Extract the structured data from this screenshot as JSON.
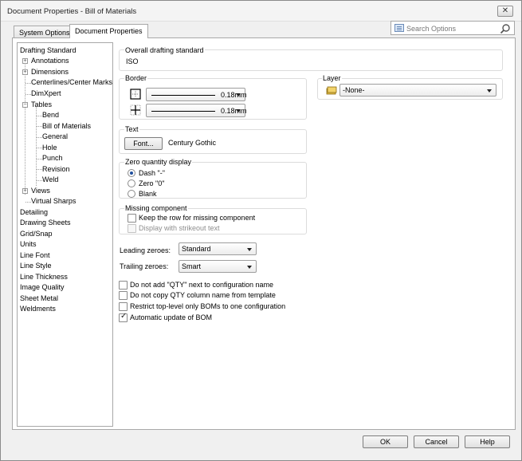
{
  "window": {
    "title": "Document Properties - Bill of Materials",
    "close_glyph": "✕"
  },
  "tabs": {
    "system_options": "System Options",
    "document_properties": "Document Properties"
  },
  "search": {
    "placeholder": "Search Options"
  },
  "tree": {
    "items": [
      "Drafting Standard",
      "Annotations",
      "Dimensions",
      "Centerlines/Center Marks",
      "DimXpert",
      "Tables",
      "Bend",
      "Bill of Materials",
      "General",
      "Hole",
      "Punch",
      "Revision",
      "Weld",
      "Views",
      "Virtual Sharps",
      "Detailing",
      "Drawing Sheets",
      "Grid/Snap",
      "Units",
      "Line Font",
      "Line Style",
      "Line Thickness",
      "Image Quality",
      "Sheet Metal",
      "Weldments"
    ]
  },
  "overall": {
    "label": "Overall drafting standard",
    "value": "ISO"
  },
  "border": {
    "label": "Border",
    "row1_value": "0.18mm",
    "row2_value": "0.18mm"
  },
  "layer": {
    "label": "Layer",
    "value": "-None-"
  },
  "text": {
    "label": "Text",
    "font_button": "Font...",
    "font_name": "Century Gothic"
  },
  "zero_qty": {
    "label": "Zero quantity display",
    "options": [
      "Dash \"-\"",
      "Zero \"0\"",
      "Blank"
    ],
    "selected": "Dash \"-\""
  },
  "missing": {
    "label": "Missing component",
    "keep_row": "Keep the row for missing component",
    "strikeout": "Display with strikeout text"
  },
  "leading": {
    "label": "Leading zeroes:",
    "value": "Standard"
  },
  "trailing": {
    "label": "Trailing zeroes:",
    "value": "Smart"
  },
  "options": {
    "no_qty": "Do not add \"QTY\" next to configuration name",
    "no_copy": "Do not copy QTY column name from template",
    "restrict": "Restrict top-level only BOMs to one configuration",
    "auto_update": "Automatic update of BOM"
  },
  "buttons": {
    "ok": "OK",
    "cancel": "Cancel",
    "help": "Help"
  },
  "colors": {
    "selection": "#1f4e9d",
    "panel_border": "#a8a8a8"
  }
}
